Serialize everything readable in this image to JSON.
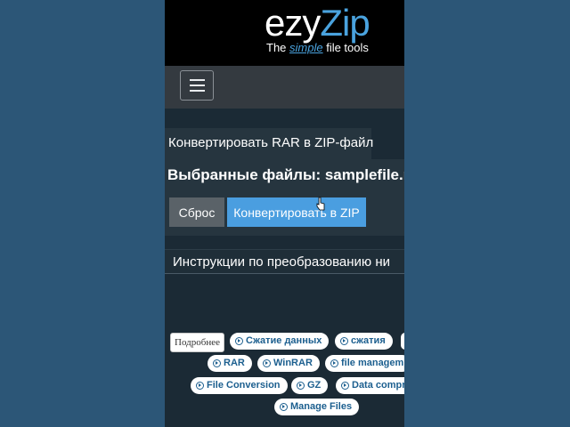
{
  "header": {
    "logo_part1": "ezy",
    "logo_part2": "Zip",
    "tagline_before": "The ",
    "tagline_highlight": "simple",
    "tagline_after": " file tools"
  },
  "page": {
    "tab_label": "Конвертировать RAR в ZIP-файл",
    "selected_files": "Выбранные файлы: samplefile.rar",
    "reset_button": "Сброс",
    "convert_button": "Конвертировать в ZIP",
    "instructions_heading": "Инструкции по преобразованию ни"
  },
  "tags": {
    "details_label": "Подробнее",
    "items": [
      "Сжатие данных",
      "сжатия",
      "RAR",
      "WinRAR",
      "file managem",
      "File Conversion",
      "GZ",
      "Data compr",
      "Manage Files"
    ]
  },
  "colors": {
    "background": "#2c5677",
    "accent": "#4a9ee0",
    "header_bg": "#000000",
    "navbar_bg": "#343a40"
  }
}
